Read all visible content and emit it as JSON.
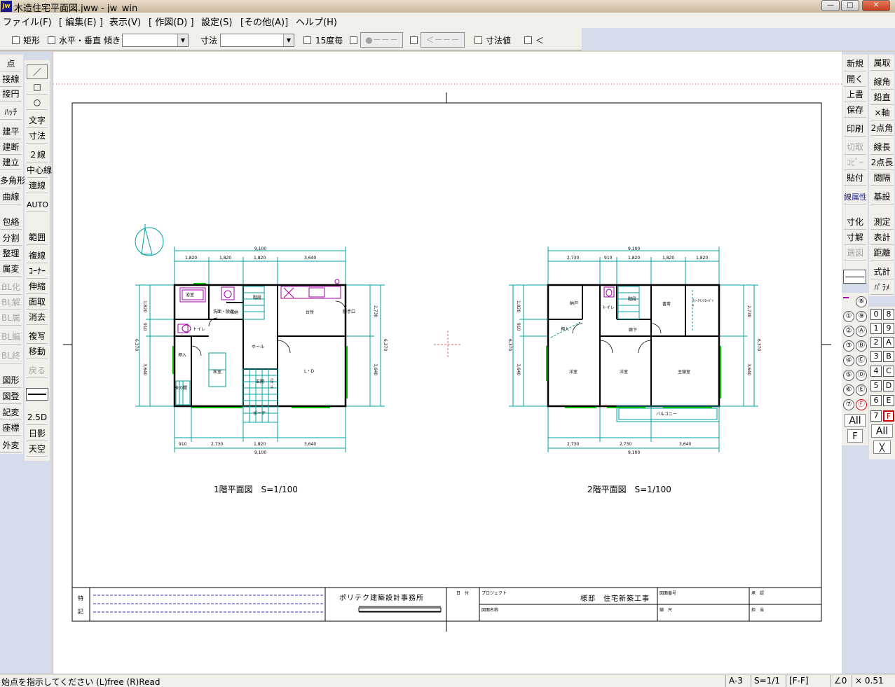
{
  "window": {
    "title": "木造住宅平面図.jww - jw_win",
    "icon_label": "jw",
    "minimize": "—",
    "maximize": "□",
    "close": "✕"
  },
  "menu": [
    "ファイル(F)",
    "[ 編集(E) ]",
    "表示(V)",
    "[ 作図(D) ]",
    "設定(S)",
    "[その他(A)]",
    "ヘルプ(H)"
  ],
  "options": {
    "rect": "矩形",
    "hv": "水平・垂直",
    "slope": "傾き",
    "dim": "寸法",
    "deg15": "15度毎",
    "btn_dot": "●－－－",
    "btn_lt": "＜－－－",
    "dimval": "寸法値",
    "lt": "＜"
  },
  "left_tools_col1": [
    "点",
    "接線",
    "接円",
    "ﾊｯﾁ",
    "建平",
    "建断",
    "建立",
    "多角形",
    "曲線",
    "包絡",
    "分割",
    "整理",
    "属変",
    "BL化",
    "BL解",
    "BL属",
    "BL編",
    "BL終",
    "図形",
    "図登",
    "記変",
    "座標",
    "外変"
  ],
  "left_tools_col2": [
    "／",
    "□",
    "○",
    "文字",
    "寸法",
    "２線",
    "中心線",
    "連線",
    "AUTO",
    "範囲",
    "複線",
    "ｺｰﾅｰ",
    "伸縮",
    "面取",
    "消去",
    "複写",
    "移動",
    "戻る",
    "2.5D",
    "日影",
    "天空"
  ],
  "right_tools_col1": [
    "新規",
    "開く",
    "上書",
    "保存",
    "印刷",
    "切取",
    "ｺﾋﾟｰ",
    "貼付",
    "線属性",
    "寸化",
    "寸解",
    "選図"
  ],
  "right_tools_col2": [
    "属取",
    "線角",
    "鉛直",
    "×軸",
    "2点角",
    "線長",
    "2点長",
    "間隔",
    "基設",
    "測定",
    "表計",
    "距離",
    "式計",
    "ﾊﾟﾗﾒ"
  ],
  "layers_circ": [
    "⑧",
    "①",
    "⑨",
    "②",
    "Ⓐ",
    "③",
    "Ⓑ",
    "④",
    "Ⓒ",
    "⑤",
    "Ⓓ",
    "⑥",
    "Ⓔ",
    "⑦",
    "Ⓕ"
  ],
  "layers_sq": [
    "0",
    "8",
    "1",
    "9",
    "2",
    "A",
    "3",
    "B",
    "4",
    "C",
    "5",
    "D",
    "6",
    "E",
    "7",
    "F"
  ],
  "layer_all": "All",
  "layer_f": "F",
  "layer_x": "╳",
  "drawing": {
    "plan1_label": "1階平面図　S=1/100",
    "plan2_label": "2階平面図　S=1/100",
    "dims1_top": [
      "1,820",
      "1,820",
      "1,820",
      "3,640"
    ],
    "dims1_bottom": [
      "910",
      "2,730",
      "1,820",
      "3,640"
    ],
    "dims2_top": [
      "2,730",
      "910",
      "1,820",
      "1,820",
      "1,820"
    ],
    "dims2_bottom": [
      "2,730",
      "2,730",
      "3,640"
    ],
    "dim_total": "9,100",
    "dims_side": [
      "1,820",
      "910",
      "3,640",
      "6,370",
      "2,730"
    ],
    "rooms1": [
      "浴室",
      "洗面・脱衣",
      "収納",
      "階段",
      "台所",
      "勝手口",
      "トイレ",
      "ホール",
      "押入",
      "和室",
      "床の間",
      "玄関",
      "ｸﾛｾﾞｯﾄ",
      "ポーチ",
      "L・D"
    ],
    "rooms2": [
      "納戸",
      "トイレ",
      "階段",
      "書斎",
      "ｳｫｰｸｲﾝｸﾛｰｾﾞｯﾄ",
      "押入",
      "廊下",
      "洋室",
      "洋室",
      "主寝室",
      "バルコニー"
    ],
    "titleblock": {
      "remarks1": "特",
      "remarks2": "記",
      "office": "ポリテク建築設計事務所",
      "date": "日　付",
      "project": "プロジェクト",
      "project_name": "様邸　住宅新築工事",
      "drawing_no": "図面番号",
      "drawing_name": "図面名称",
      "scale": "縮　尺",
      "approved": "承　認",
      "drafter": "担　当"
    }
  },
  "status": {
    "message": "始点を指示してください (L)free (R)Read",
    "paper": "A-3",
    "scale": "S=1/1",
    "group": "[F-F]",
    "angle": "∠0",
    "factor": "× 0.51"
  }
}
